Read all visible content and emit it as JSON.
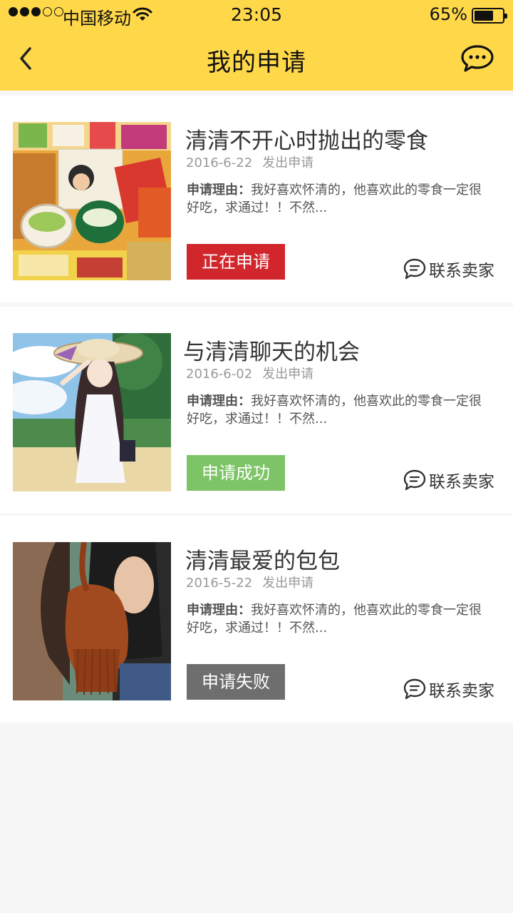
{
  "status_bar": {
    "carrier": "中国移动",
    "time": "23:05",
    "battery": "65%",
    "battery_level": 0.65,
    "signal_strength": 3
  },
  "nav": {
    "title": "我的申请",
    "back_icon": "chevron-left-icon",
    "chat_icon": "chat-bubble-icon"
  },
  "colors": {
    "header_bg": "#ffd84a",
    "status_pending": "#d0262c",
    "status_success": "#7cc466",
    "status_failed": "#6e6e6e"
  },
  "applications": [
    {
      "title": "清清不开心时抛出的零食",
      "date": "2016-6-22",
      "action": "发出申请",
      "reason_label": "申请理由：",
      "reason": "我好喜欢怀清的，他喜欢此的零食一定很好吃，求通过！！不然...",
      "status": "正在申请",
      "status_color": "#d0262c",
      "contact": "联系卖家",
      "image": "snacks-photo"
    },
    {
      "title": "与清清聊天的机会",
      "date": "2016-6-02",
      "action": "发出申请",
      "reason_label": "申请理由：",
      "reason": "我好喜欢怀清的，他喜欢此的零食一定很好吃，求通过！！不然...",
      "status": "申请成功",
      "status_color": "#7cc466",
      "contact": "联系卖家",
      "image": "anime-girl-illustration"
    },
    {
      "title": "清清最爱的包包",
      "date": "2016-5-22",
      "action": "发出申请",
      "reason_label": "申请理由：",
      "reason": "我好喜欢怀清的，他喜欢此的零食一定很好吃，求通过！！不然...",
      "status": "申请失败",
      "status_color": "#6e6e6e",
      "contact": "联系卖家",
      "image": "leather-backpack-photo"
    }
  ]
}
